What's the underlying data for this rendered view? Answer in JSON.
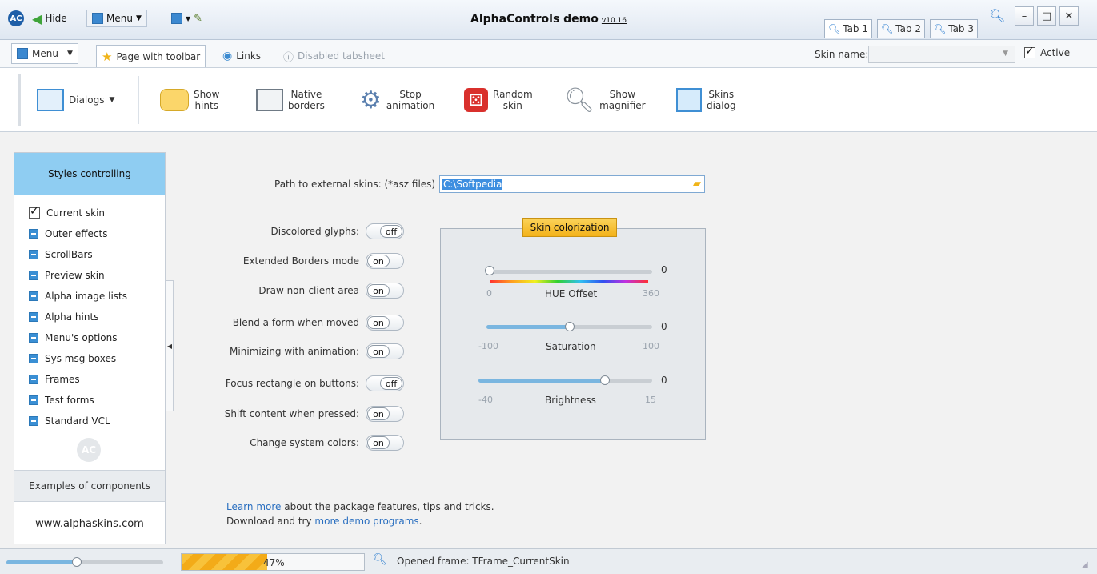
{
  "titlebar": {
    "hide_label": "Hide",
    "menu_label": "Menu",
    "title": "AlphaControls demo",
    "version": "v10.16",
    "tabs": [
      {
        "label": "Tab 1"
      },
      {
        "label": "Tab 2"
      },
      {
        "label": "Tab 3"
      }
    ],
    "window_buttons": [
      "minimize-icon",
      "maximize-icon",
      "close-icon"
    ]
  },
  "pagebar": {
    "menu_label": "Menu",
    "tabs": [
      {
        "label": "Page with toolbar",
        "selected": true
      },
      {
        "label": "Links"
      },
      {
        "label": "Disabled tabsheet"
      }
    ],
    "skin_name_label": "Skin name:",
    "skin_name_value": "",
    "active_label": "Active",
    "active_checked": true
  },
  "toolbar": {
    "items": [
      {
        "label": "Dialogs",
        "icon": "dialog-window-icon"
      },
      {
        "label": "Show\nhints",
        "icon": "hint-balloon-icon"
      },
      {
        "label": "Native\nborders",
        "icon": "window-borders-icon"
      },
      {
        "label": "Stop\nanimation",
        "icon": "gears-icon"
      },
      {
        "label": "Random\nskin",
        "icon": "dice-icon"
      },
      {
        "label": "Show\nmagnifier",
        "icon": "magnifier-icon"
      },
      {
        "label": "Skins\ndialog",
        "icon": "skins-dialog-icon"
      }
    ]
  },
  "sidebar": {
    "header": "Styles controlling",
    "items": [
      {
        "label": "Current skin",
        "checked": true
      },
      {
        "label": "Outer effects"
      },
      {
        "label": "ScrollBars"
      },
      {
        "label": "Preview skin"
      },
      {
        "label": "Alpha image lists"
      },
      {
        "label": "Alpha hints"
      },
      {
        "label": "Menu's options"
      },
      {
        "label": "Sys msg boxes"
      },
      {
        "label": "Frames"
      },
      {
        "label": "Test forms"
      },
      {
        "label": "Standard VCL"
      }
    ],
    "examples_label": "Examples of components",
    "site": "www.alphaskins.com"
  },
  "main": {
    "path_label": "Path to external skins: (*asz files)",
    "path_value": "C:\\Softpedia",
    "options": [
      {
        "label": "Discolored glyphs:",
        "state": "off"
      },
      {
        "label": "Extended Borders mode",
        "state": "on"
      },
      {
        "label": "Draw non-client area",
        "state": "on"
      },
      {
        "label": "Blend a form when moved",
        "state": "on"
      },
      {
        "label": "Minimizing with animation:",
        "state": "on"
      },
      {
        "label": "Focus rectangle on buttons:",
        "state": "off"
      },
      {
        "label": "Shift content when pressed:",
        "state": "on"
      },
      {
        "label": "Change system colors:",
        "state": "on"
      }
    ],
    "colorization": {
      "title": "Skin colorization",
      "sliders": [
        {
          "name": "HUE Offset",
          "min": "0",
          "max": "360",
          "value": 0,
          "level": 0.0
        },
        {
          "name": "Saturation",
          "min": "-100",
          "max": "100",
          "value": 0,
          "level": 0.5
        },
        {
          "name": "Brightness",
          "min": "-40",
          "max": "15",
          "value": 0,
          "level": 0.727
        }
      ]
    },
    "links": {
      "line1_link": "Learn more",
      "line1_text": " about the package features, tips and tricks.",
      "line2_text": "Download and try ",
      "line2_link": "more demo programs",
      "line2_end": "."
    }
  },
  "statusbar": {
    "slider_level": 0.45,
    "progress": "47%",
    "progress_level": 0.47,
    "status_text": "Opened frame: TFrame_CurrentSkin"
  },
  "colors": {
    "accent": "#8fcdf2",
    "toggle_title": "#f3b21a",
    "link": "#2a6fc0"
  }
}
